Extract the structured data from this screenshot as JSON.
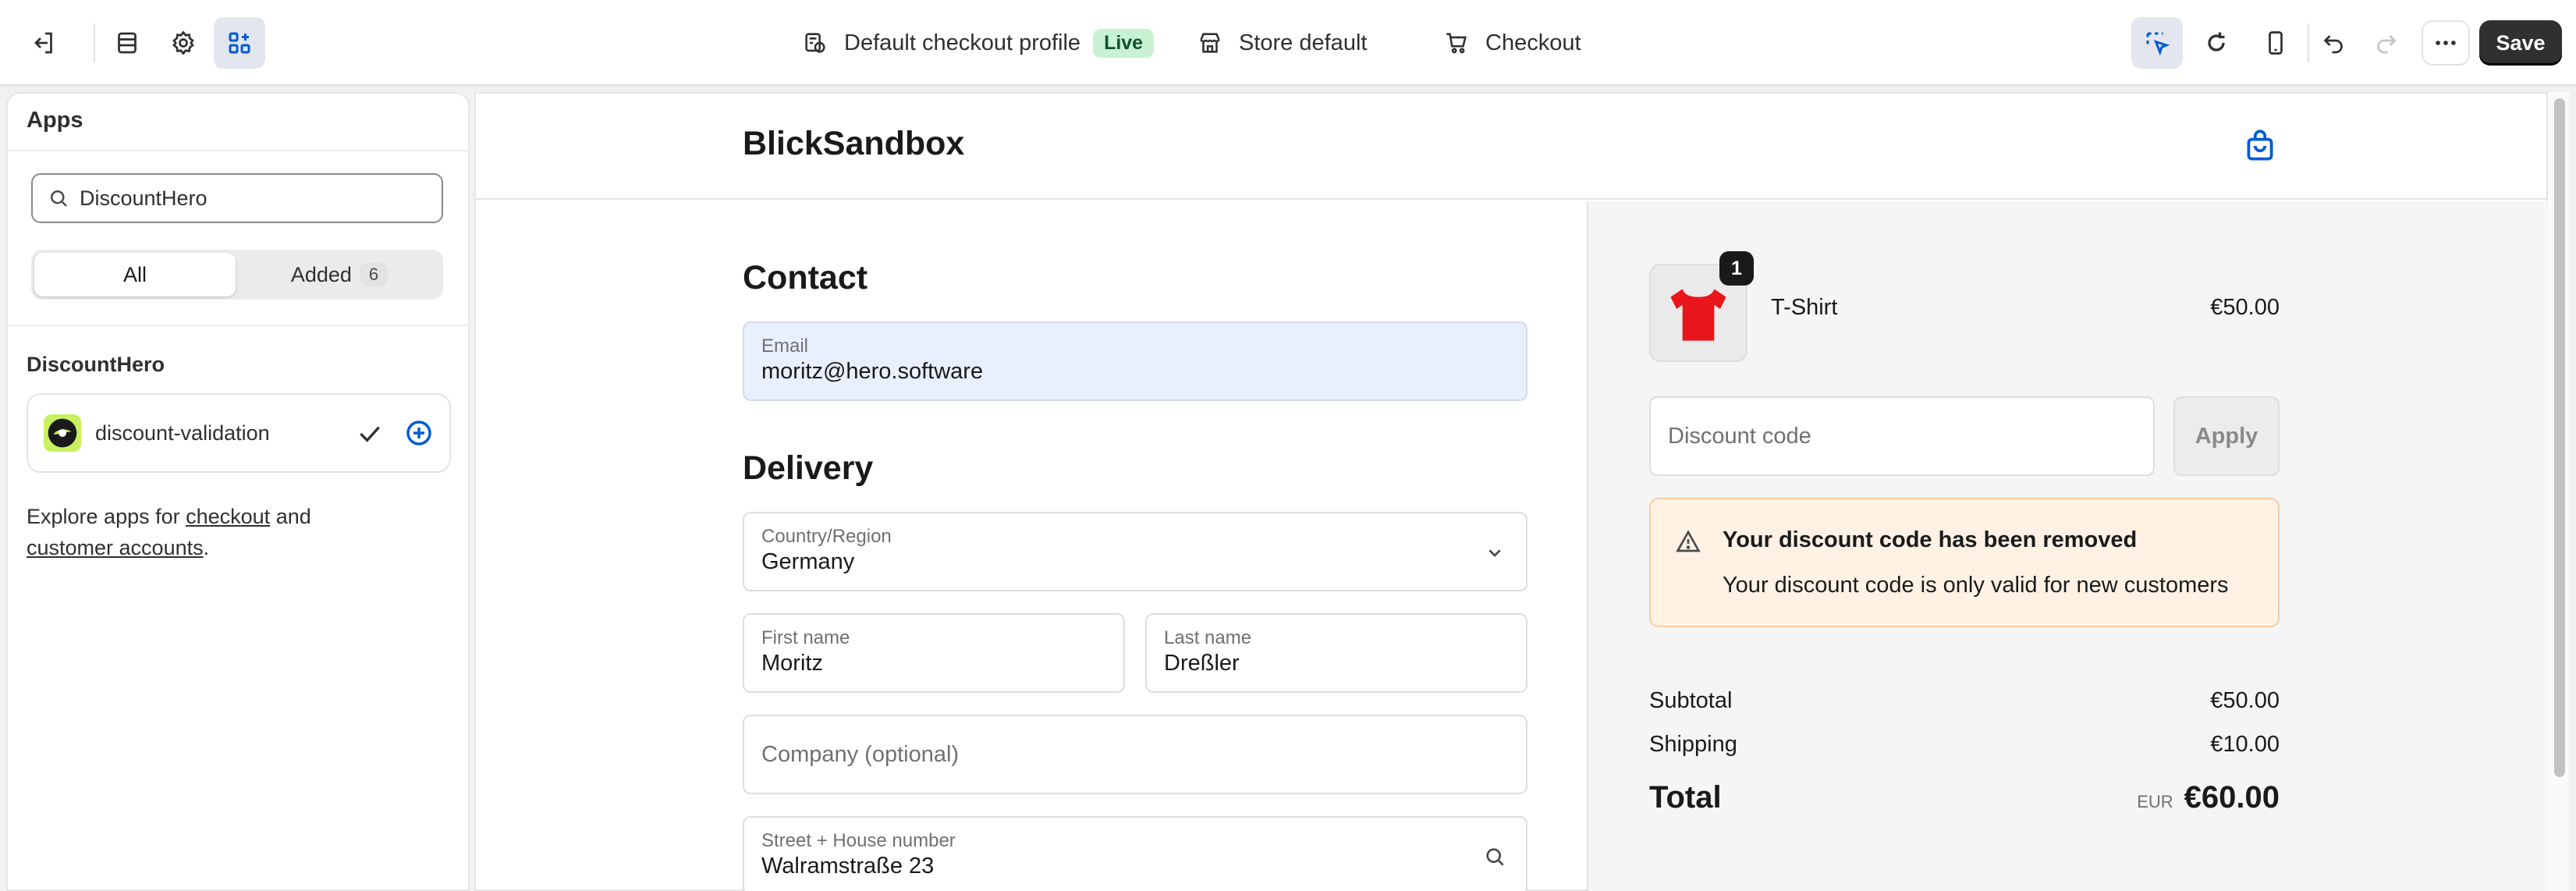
{
  "topbar": {
    "icons": [
      "exit-icon",
      "layout-sections-icon",
      "gear-icon",
      "apps-icon"
    ],
    "profile_label": "Default checkout profile",
    "live_badge": "Live",
    "store_label": "Store default",
    "page_label": "Checkout",
    "right_icons": [
      "inspector-icon",
      "reload-icon",
      "mobile-icon",
      "undo-icon",
      "redo-icon",
      "more-icon"
    ],
    "save_label": "Save"
  },
  "sidebar": {
    "title": "Apps",
    "search": {
      "value": "DiscountHero"
    },
    "tabs": [
      {
        "label": "All",
        "selected": true
      },
      {
        "label": "Added",
        "count": "6",
        "selected": false
      }
    ],
    "section_title": "DiscountHero",
    "apps": [
      {
        "name": "discount-validation",
        "added": true
      }
    ],
    "explore": {
      "prefix": "Explore apps for ",
      "link1": "checkout",
      "middle": " and",
      "link2": "customer accounts",
      "suffix": "."
    }
  },
  "checkout": {
    "shop_name": "BlickSandbox",
    "contact_heading": "Contact",
    "email": {
      "label": "Email",
      "value": "moritz@hero.software"
    },
    "delivery_heading": "Delivery",
    "country": {
      "label": "Country/Region",
      "value": "Germany"
    },
    "first_name": {
      "label": "First name",
      "value": "Moritz"
    },
    "last_name": {
      "label": "Last name",
      "value": "Dreßler"
    },
    "company": {
      "placeholder": "Company (optional)"
    },
    "street": {
      "label": "Street + House number",
      "value": "Walramstraße 23"
    }
  },
  "summary": {
    "product": {
      "name": "T-Shirt",
      "price": "€50.00",
      "quantity": "1",
      "color": "#e8151b"
    },
    "discount": {
      "placeholder": "Discount code",
      "apply_label": "Apply"
    },
    "alert": {
      "title": "Your discount code has been removed",
      "body": "Your discount code is only valid for new customers"
    },
    "subtotal": {
      "label": "Subtotal",
      "value": "€50.00"
    },
    "shipping": {
      "label": "Shipping",
      "value": "€10.00"
    },
    "total": {
      "label": "Total",
      "currency": "EUR",
      "value": "€60.00"
    }
  },
  "colors": {
    "accent": "#005bd3",
    "alert_bg": "#fff2e5",
    "live_bg": "#c9f2d2"
  }
}
